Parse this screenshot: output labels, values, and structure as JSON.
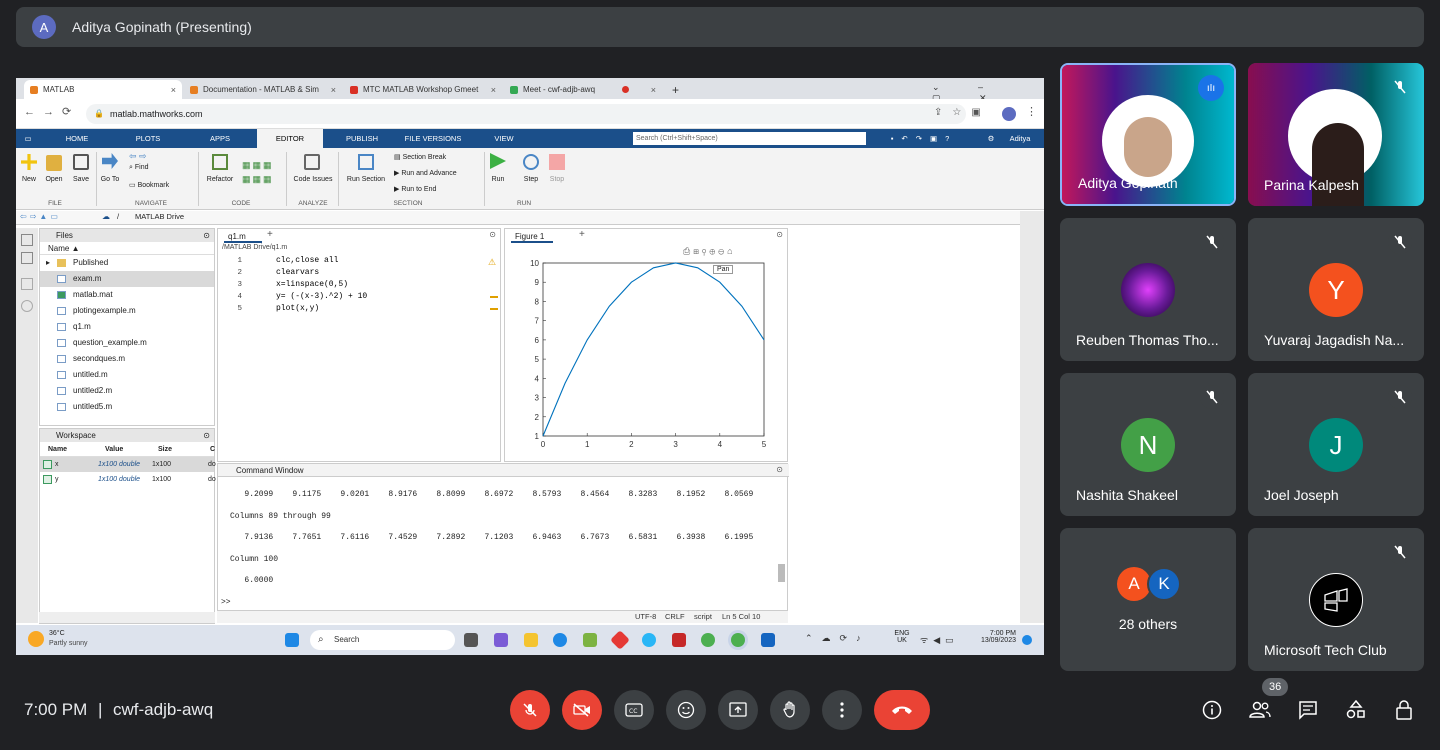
{
  "meeting": {
    "presenter_initial": "A",
    "presenter_label": "Aditya Gopinath (Presenting)",
    "time": "7:00 PM",
    "separator": "|",
    "code": "cwf-adjb-awq",
    "participant_count": "36"
  },
  "browser": {
    "tabs": [
      {
        "title": "MATLAB",
        "close": "×"
      },
      {
        "title": "Documentation - MATLAB & Sim",
        "close": "×"
      },
      {
        "title": "MTC MATLAB Workshop Gmeet",
        "close": "×"
      },
      {
        "title": "Meet - cwf-adjb-awq",
        "close": "×"
      }
    ],
    "new_tab": "+",
    "url": "matlab.mathworks.com"
  },
  "matlab": {
    "tabs": [
      "HOME",
      "PLOTS",
      "APPS",
      "EDITOR",
      "PUBLISH",
      "FILE VERSIONS",
      "VIEW"
    ],
    "search_placeholder": "Search (Ctrl+Shift+Space)",
    "user": "Aditya",
    "ribbon": {
      "new": "New",
      "open": "Open",
      "save": "Save",
      "goto": "Go To",
      "find": "Find",
      "bookmark": "Bookmark",
      "refactor": "Refactor",
      "code_issues": "Code Issues",
      "run_section": "Run Section",
      "section_break": "Section Break",
      "run_advance": "Run and Advance",
      "run_end": "Run to End",
      "run": "Run",
      "step": "Step",
      "stop": "Stop",
      "groups": [
        "FILE",
        "NAVIGATE",
        "CODE",
        "ANALYZE",
        "SECTION",
        "RUN"
      ]
    },
    "path": "MATLAB Drive",
    "path_sep": "/",
    "files_title": "Files",
    "files_col": "Name ▲",
    "files": [
      "Published",
      "exam.m",
      "matlab.mat",
      "plotingexample.m",
      "q1.m",
      "question_example.m",
      "secondques.m",
      "untitled.m",
      "untitled2.m",
      "untitled5.m"
    ],
    "workspace_title": "Workspace",
    "ws_cols": [
      "Name",
      "Value",
      "Size",
      "C"
    ],
    "ws_rows": [
      {
        "name": "x",
        "value": "1x100 double",
        "size": "1x100",
        "cls": "do"
      },
      {
        "name": "y",
        "value": "1x100 double",
        "size": "1x100",
        "cls": "do"
      }
    ],
    "editor_tab": "q1.m",
    "editor_path": "/MATLAB Drive/q1.m",
    "code": [
      {
        "n": "1",
        "t": "clc,close all"
      },
      {
        "n": "2",
        "t": "clearvars"
      },
      {
        "n": "3",
        "t": "x=linspace(0,5)"
      },
      {
        "n": "4",
        "t": "y= (-(x-3).^2) + 10"
      },
      {
        "n": "5",
        "t": "plot(x,y)"
      }
    ],
    "figure_tab": "Figure 1",
    "tooltip": "Pan",
    "cmd_title": "Command Window",
    "cmd_lines": [
      "   9.2099    9.1175    9.0201    8.9176    8.8099    8.6972    8.5793    8.4564    8.3283    8.1952    8.0569",
      "Columns 89 through 99",
      "   7.9136    7.7651    7.6116    7.4529    7.2892    7.1203    6.9463    6.7673    6.5831    6.3938    6.1995",
      "Column 100",
      "   6.0000",
      ">>"
    ],
    "status": [
      "UTF-8",
      "CRLF",
      "script",
      "Ln 5 Col 10"
    ]
  },
  "taskbar": {
    "temp": "36°C",
    "weather": "Partly sunny",
    "search": "Search",
    "lang": "ENG",
    "region": "UK",
    "time": "7:00 PM",
    "date": "13/09/2023"
  },
  "participants": [
    {
      "name": "Aditya Gopinath",
      "video": true
    },
    {
      "name": "Parina Kalpesh",
      "video": true
    },
    {
      "name": "Reuben Thomas Tho...",
      "initial": "",
      "color": "#6a1b9a"
    },
    {
      "name": "Yuvaraj Jagadish Na...",
      "initial": "Y",
      "color": "#f4511e"
    },
    {
      "name": "Nashita Shakeel",
      "initial": "N",
      "color": "#43a047"
    },
    {
      "name": "Joel Joseph",
      "initial": "J",
      "color": "#00897b"
    },
    {
      "name": "28 others",
      "initials": [
        "A",
        "K"
      ]
    },
    {
      "name": "Microsoft Tech Club"
    }
  ],
  "chart_data": {
    "type": "line",
    "title": "",
    "xlabel": "",
    "ylabel": "",
    "xlim": [
      0,
      5
    ],
    "ylim": [
      1,
      10
    ],
    "xticks": [
      "0",
      "1",
      "2",
      "3",
      "4",
      "5"
    ],
    "yticks": [
      "1",
      "2",
      "3",
      "4",
      "5",
      "6",
      "7",
      "8",
      "9",
      "10"
    ],
    "series": [
      {
        "formula": "y = -(x-3)^2 + 10",
        "x": [
          0,
          0.5,
          1,
          1.5,
          2,
          2.5,
          3,
          3.5,
          4,
          4.5,
          5
        ],
        "y": [
          1,
          3.75,
          6,
          7.75,
          9,
          9.75,
          10,
          9.75,
          9,
          7.75,
          6
        ]
      }
    ],
    "grid": false,
    "color": "#0072bd"
  },
  "colors": {
    "meet_bg": "#202124",
    "tile": "#3c4043",
    "end_call": "#ea4335",
    "muted": "#ea4335",
    "matlab_blue": "#1b4f8a",
    "active_tile_border": "#8ab4f8"
  }
}
